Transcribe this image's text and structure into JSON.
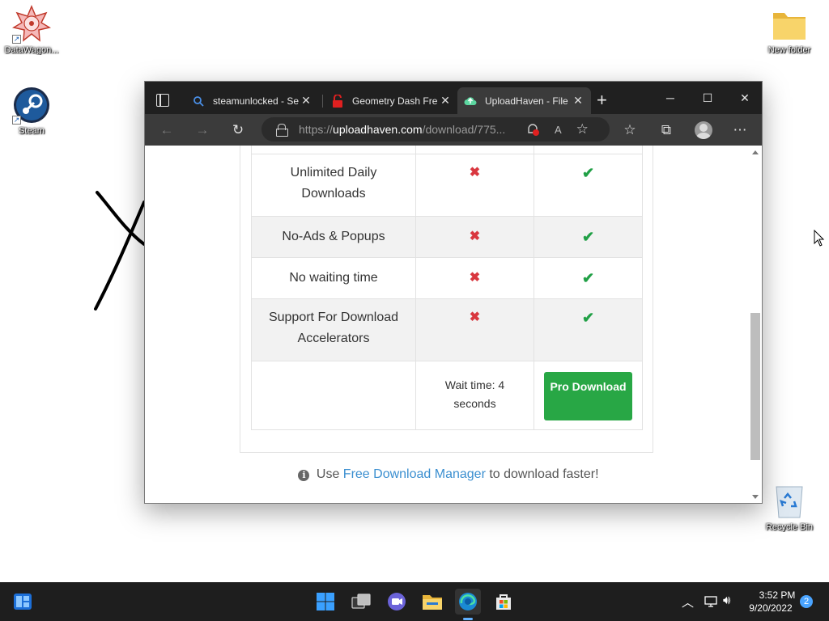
{
  "desktop": {
    "icons": [
      {
        "label": "DataWagon..."
      },
      {
        "label": "Steam"
      },
      {
        "label": "New folder"
      },
      {
        "label": "Recycle Bin"
      }
    ]
  },
  "browser": {
    "tabs": [
      {
        "title": "steamunlocked - Se",
        "close": "✕"
      },
      {
        "title": "Geometry Dash Fre",
        "close": "✕"
      },
      {
        "title": "UploadHaven - File",
        "close": "✕"
      }
    ],
    "new_tab": "+",
    "window_controls": {
      "minimize": "─",
      "maximize": "☐",
      "close": "✕"
    },
    "address": {
      "prefix": "https://",
      "domain": "uploadhaven.com",
      "path": "/download/775..."
    },
    "toolbar_icons": [
      "back-arrow",
      "forward-arrow",
      "refresh",
      "lock",
      "notification-bell",
      "read-aloud",
      "add-favorite",
      "favorites",
      "collections",
      "profile",
      "more"
    ]
  },
  "page": {
    "features": [
      {
        "name": "Unlimited Daily Downloads",
        "free": "✖",
        "pro": "✔"
      },
      {
        "name": "No-Ads & Popups",
        "free": "✖",
        "pro": "✔"
      },
      {
        "name": "No waiting time",
        "free": "✖",
        "pro": "✔"
      },
      {
        "name": "Support For Download Accelerators",
        "free": "✖",
        "pro": "✔"
      }
    ],
    "wait_text": "Wait time: 4 seconds",
    "pro_button": "Pro Download",
    "tip_prefix": "Use",
    "tip_link": "Free Download Manager",
    "tip_suffix": "to download faster!"
  },
  "taskbar": {
    "time": "3:52 PM",
    "date": "9/20/2022",
    "notification_count": "2"
  },
  "colors": {
    "check": "#21a046",
    "cross": "#d9373f",
    "pro_button": "#28a745",
    "link": "#3b8fd0"
  }
}
